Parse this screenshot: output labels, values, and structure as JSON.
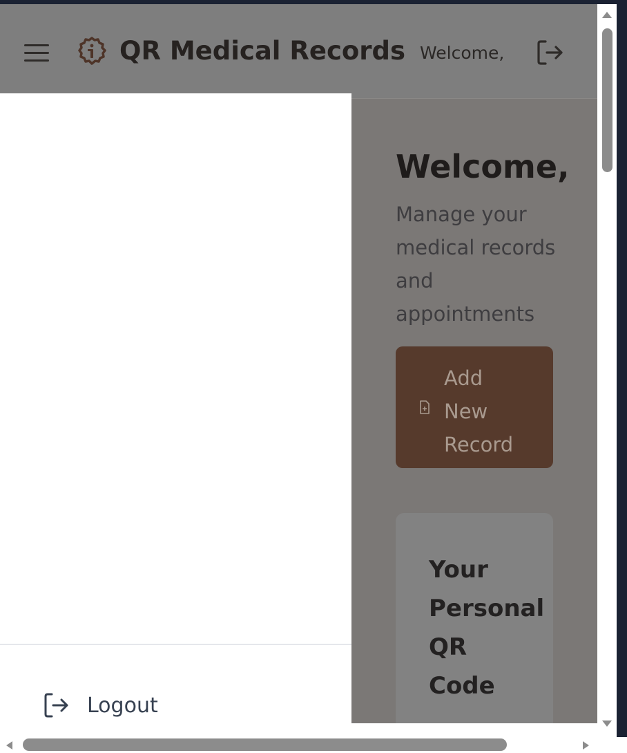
{
  "header": {
    "app_title": "QR Medical Records",
    "welcome": "Welcome,",
    "icons": {
      "menu": "hamburger-menu-icon",
      "logo": "medical-seal-icon",
      "logout": "logout-icon"
    }
  },
  "main": {
    "title": "Welcome,",
    "subtitle": "Manage your medical records and appointments",
    "add_record_label": "Add New Record",
    "qr_card_title": "Your Personal QR Code"
  },
  "drawer": {
    "logout_label": "Logout"
  },
  "colors": {
    "brand_brown": "#563a2c",
    "drawer_bg": "#ffffff",
    "overlay": "#7b7876"
  }
}
